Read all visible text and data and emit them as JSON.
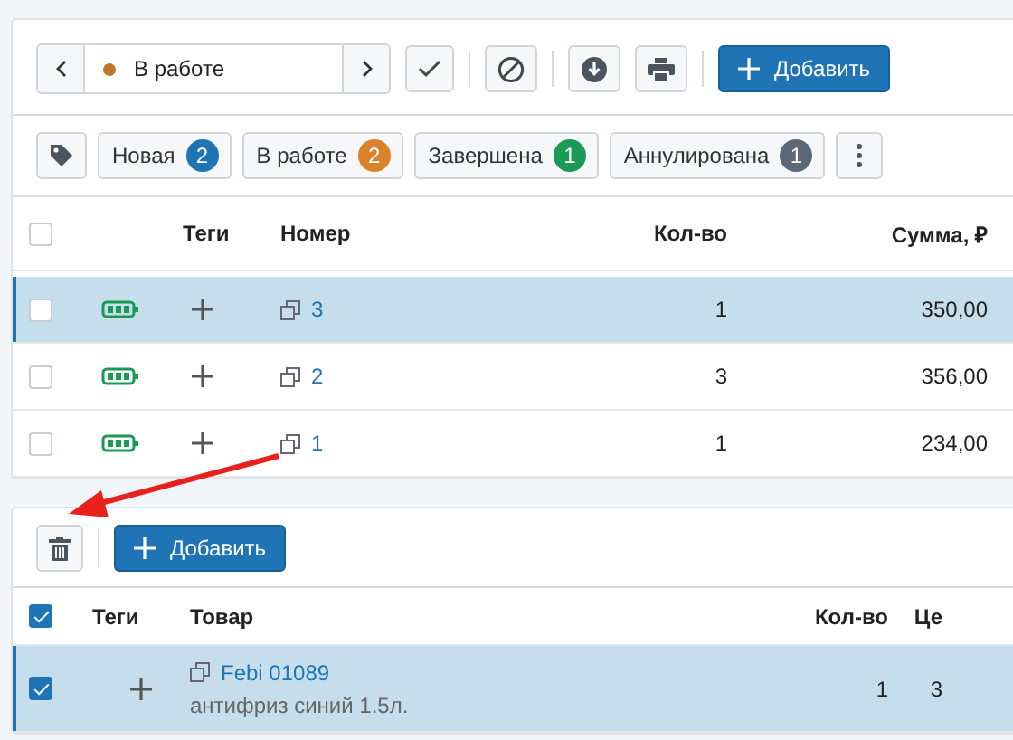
{
  "toolbar": {
    "status": "В работе",
    "add_button": "Добавить"
  },
  "filters": [
    {
      "label": "Новая",
      "count": "2",
      "color": "#1f74b6"
    },
    {
      "label": "В работе",
      "count": "2",
      "color": "#d9822b"
    },
    {
      "label": "Завершена",
      "count": "1",
      "color": "#1a9a55"
    },
    {
      "label": "Аннулирована",
      "count": "1",
      "color": "#5a6878"
    }
  ],
  "orders_table": {
    "all_checked": false,
    "columns": [
      "Теги",
      "Номер",
      "Кол-во",
      "Сумма, ₽"
    ],
    "rows": [
      {
        "number": "3",
        "qty": "1",
        "sum": "350,00",
        "checked": false,
        "selected": true
      },
      {
        "number": "2",
        "qty": "3",
        "sum": "356,00",
        "checked": false,
        "selected": false
      },
      {
        "number": "1",
        "qty": "1",
        "sum": "234,00",
        "checked": false,
        "selected": false
      }
    ]
  },
  "items_toolbar": {
    "add_button": "Добавить"
  },
  "items_table": {
    "all_checked": true,
    "columns": [
      "Теги",
      "Товар",
      "Кол-во",
      "Це"
    ],
    "rows": [
      {
        "name": "Febi 01089",
        "description": "антифриз синий 1.5л.",
        "qty": "1",
        "price": "3",
        "checked": true,
        "selected": true
      }
    ]
  }
}
